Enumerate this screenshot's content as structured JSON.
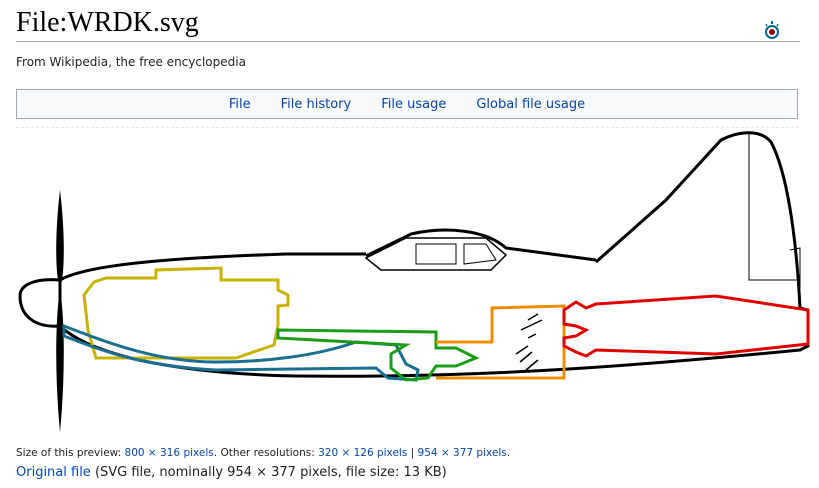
{
  "page": {
    "title": "File:WRDK.svg",
    "tagline": "From Wikipedia, the free encyclopedia"
  },
  "tabs": [
    "File",
    "File history",
    "File usage",
    "Global file usage"
  ],
  "icons": {
    "commons": "commons-logo-icon"
  },
  "preview_info": {
    "size_prefix": "Size of this preview: ",
    "size_link": "800 × 316 pixels",
    "other_prefix": ". Other resolutions: ",
    "res1": "320 × 126 pixels",
    "sep": " | ",
    "res2": "954 × 377 pixels",
    "suffix": "."
  },
  "original": {
    "link": "Original file",
    "details": " (SVG file, nominally 954 × 377 pixels, file size: 13 KB)"
  },
  "colors": {
    "link": "#0645ad",
    "engine": "#c8b400",
    "intake": "#1b6f8f",
    "duct": "#1a9e1a",
    "turbine": "#f08c00",
    "exhaust": "#e00000"
  }
}
